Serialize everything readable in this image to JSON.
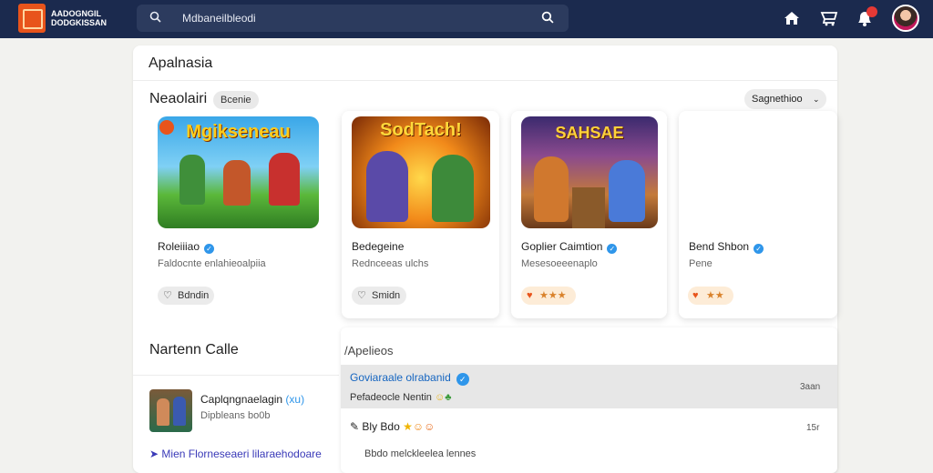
{
  "header": {
    "brand_line1": "AADOGNGIL",
    "brand_line2": "DODGKISSAN",
    "search_text": "Mdbaneilbleodi"
  },
  "page": {
    "title": "Apalnasia",
    "section_title": "Neaolairi",
    "section_chip": "Bcenie",
    "sort_label": "Sagnethioo"
  },
  "games": [
    {
      "thumb_title": "Mgikseneau",
      "name": "Roleiiiao",
      "subtitle": "Faldocnte enlahieoalpiia",
      "button": "Bdndin",
      "button_icon": "heart-icon",
      "verified": true
    },
    {
      "thumb_title": "SodTach!",
      "name": "Bedegeine",
      "subtitle": "Rednceeas ulchs",
      "button": "Smidn",
      "button_icon": "heart-icon",
      "verified": false
    },
    {
      "thumb_title": "SAHSAE",
      "name": "Goplier Caimtion",
      "subtitle": "Mesesoeeenaplo",
      "button": "★★★",
      "button_icon": "heart-icon",
      "verified": true
    },
    {
      "thumb_title": "",
      "name": "Bend Shbon",
      "subtitle": "Pene",
      "button": "★★",
      "button_icon": "heart-icon",
      "verified": true
    }
  ],
  "left": {
    "title": "Nartenn Calle",
    "item_name": "Caplqngnaelagin",
    "item_tag": "(xu)",
    "item_sub": "Dipbleans bo0b",
    "link": "Mien Florneseaeri lilaraehodoare"
  },
  "right": {
    "title": "/Apelieos",
    "rows": [
      {
        "name": "Goviaraale olrabanid",
        "sub": "Pefadeocle Nentin",
        "time": "3aan"
      },
      {
        "name": "Bly Bdo",
        "time": "15r"
      },
      {
        "text": "Bbdo melckleelea lennes"
      }
    ]
  },
  "colors": {
    "topbar": "#1b2a4e",
    "accent_orange": "#e8541b",
    "verified_blue": "#2f96ea",
    "link_blue": "#1565c0"
  }
}
